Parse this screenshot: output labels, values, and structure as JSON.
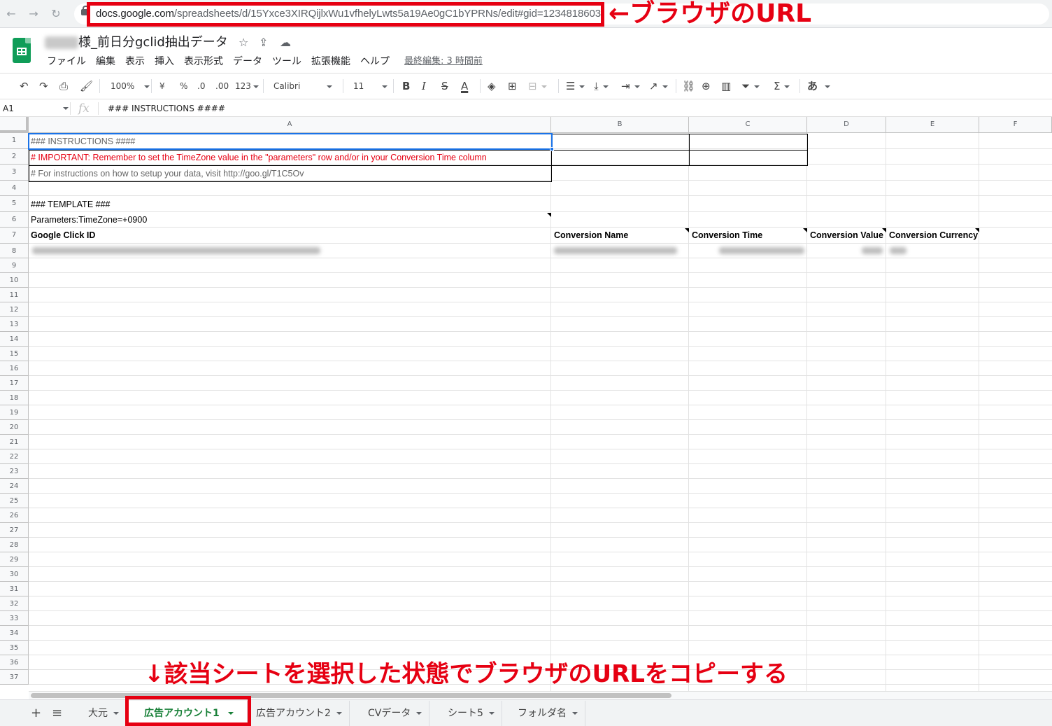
{
  "browser": {
    "url_host": "docs.google.com",
    "url_path": "/spreadsheets/d/15Yxce3XIRQijlxWu1vfhelyLwts5a19Ae0gC1bYPRNs/edit#gid=1234818603"
  },
  "annotations": {
    "url_label": "←ブラウザのURL",
    "bottom_label": "↓該当シートを選択した状態でブラウザのURLをコピーする"
  },
  "doc": {
    "title_visible": "様_前日分gclid抽出データ",
    "menu": [
      "ファイル",
      "編集",
      "表示",
      "挿入",
      "表示形式",
      "データ",
      "ツール",
      "拡張機能",
      "ヘルプ"
    ],
    "last_edit": "最終編集: 3 時間前"
  },
  "toolbar": {
    "zoom": "100%",
    "currency": "¥",
    "percent": "%",
    "dec_decrease": ".0",
    "dec_increase": ".00",
    "format": "123",
    "font": "Calibri",
    "font_size": "11",
    "bold": "B",
    "italic": "I",
    "strike": "S",
    "text_color": "A",
    "sigma": "Σ",
    "input_tool": "あ"
  },
  "formula_bar": {
    "cell_ref": "A1",
    "fx": "fx",
    "content": "### INSTRUCTIONS ####"
  },
  "grid": {
    "columns": [
      "A",
      "B",
      "C",
      "D",
      "E",
      "F"
    ],
    "rows": [
      "1",
      "2",
      "3",
      "4",
      "5",
      "6",
      "7",
      "8",
      "9",
      "10",
      "11",
      "12",
      "13",
      "14",
      "15",
      "16",
      "17",
      "18",
      "19",
      "20",
      "21",
      "22",
      "23",
      "24",
      "25",
      "26",
      "27",
      "28",
      "29",
      "30",
      "31",
      "32",
      "33",
      "34",
      "35",
      "36",
      "37"
    ],
    "cells": {
      "a1": "### INSTRUCTIONS ####",
      "a2": "# IMPORTANT: Remember to set the TimeZone value in the \"parameters\" row and/or in your Conversion Time column",
      "a3": "# For instructions on how to setup your data, visit http://goo.gl/T1C5Ov",
      "a5": "### TEMPLATE ###",
      "a6": "Parameters:TimeZone=+0900",
      "a7": "Google Click ID",
      "b7": "Conversion Name",
      "c7": "Conversion Time",
      "d7": "Conversion Value",
      "e7": "Conversion Currency"
    }
  },
  "sheet_tabs": {
    "add": "+",
    "all": "≡",
    "tabs": [
      "大元",
      "広告アカウント1",
      "広告アカウント2",
      "CVデータ",
      "シート5",
      "フォルダ名"
    ],
    "active_index": 1
  },
  "colors": {
    "annotation_red": "#e60012",
    "selection_blue": "#1a73e8",
    "active_tab_green": "#188038",
    "sheets_green": "#0f9d58"
  }
}
